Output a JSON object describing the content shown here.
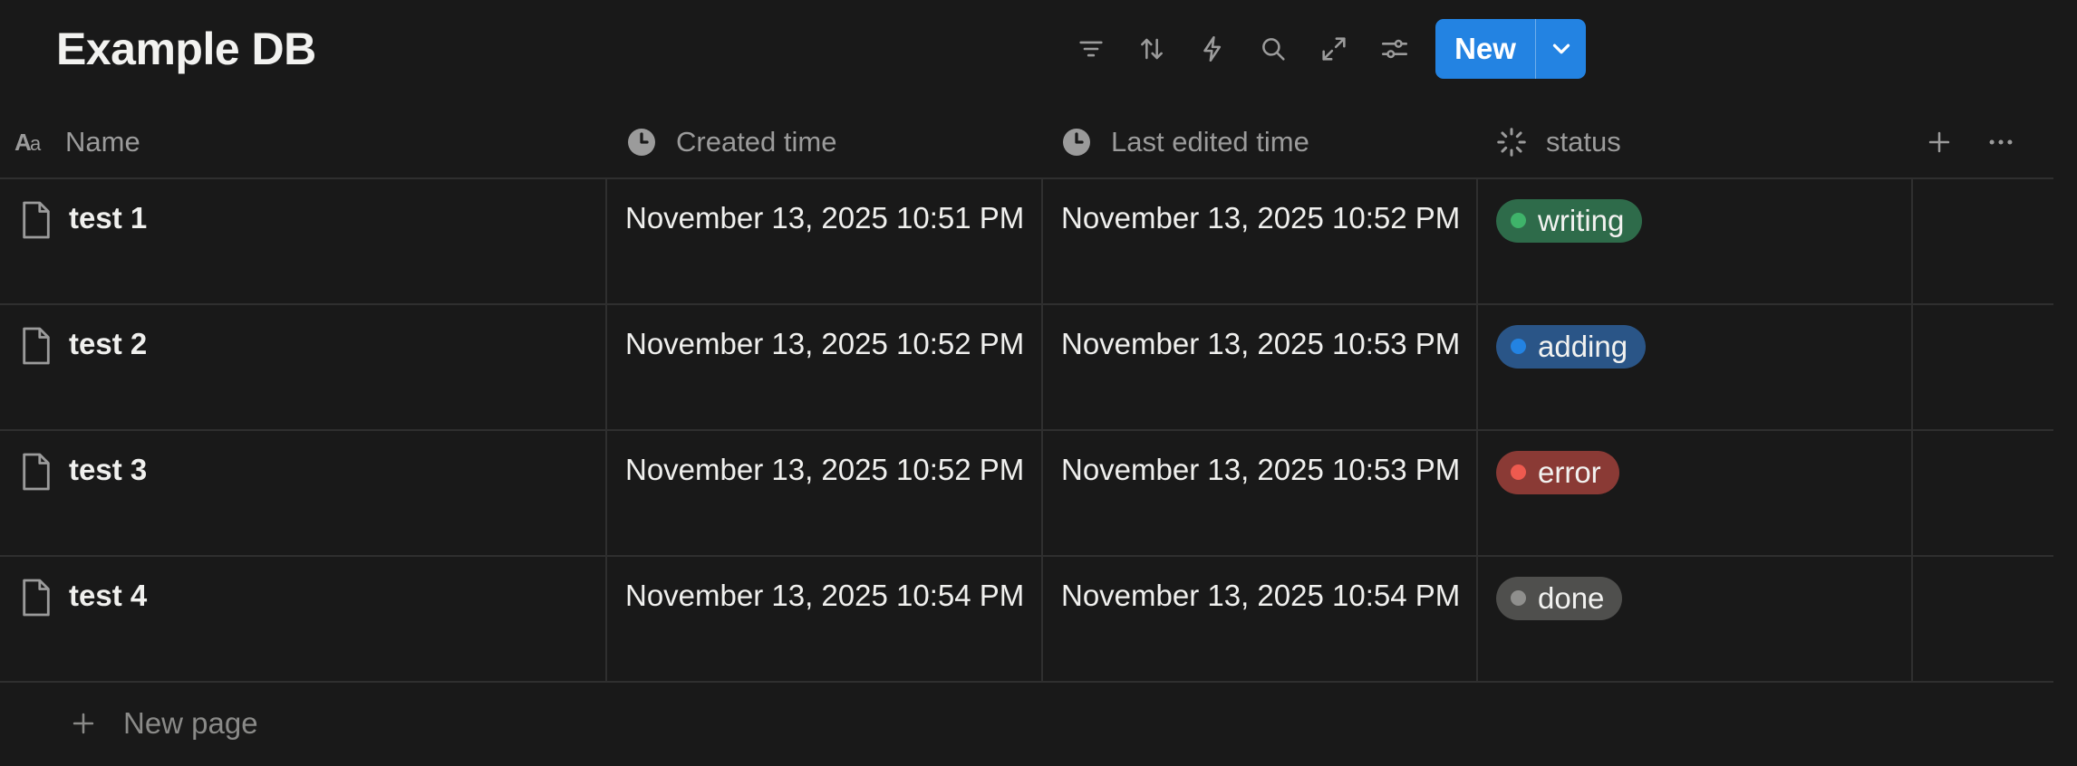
{
  "database": {
    "title": "Example DB"
  },
  "toolbar": {
    "icons": [
      "filter-icon",
      "sort-icon",
      "automation-bolt-icon",
      "search-icon",
      "expand-icon",
      "settings-sliders-icon"
    ],
    "new_label": "New",
    "accent_color": "#2383e2"
  },
  "columns": {
    "name": "Name",
    "created": "Created time",
    "edited": "Last edited time",
    "status": "status"
  },
  "rows": [
    {
      "name": "test 1",
      "created": "November 13, 2025 10:51 PM",
      "edited": "November 13, 2025 10:52 PM",
      "status": "writing",
      "status_color": "#2e6b4a",
      "dot_color": "#3fb36a"
    },
    {
      "name": "test 2",
      "created": "November 13, 2025 10:52 PM",
      "edited": "November 13, 2025 10:53 PM",
      "status": "adding",
      "status_color": "#2a5587",
      "dot_color": "#2383e2"
    },
    {
      "name": "test 3",
      "created": "November 13, 2025 10:52 PM",
      "edited": "November 13, 2025 10:53 PM",
      "status": "error",
      "status_color": "#8a3a35",
      "dot_color": "#ee5a4f"
    },
    {
      "name": "test 4",
      "created": "November 13, 2025 10:54 PM",
      "edited": "November 13, 2025 10:54 PM",
      "status": "done",
      "status_color": "#4f4f4d",
      "dot_color": "#8f8f8d"
    }
  ],
  "footer": {
    "new_page_label": "New page"
  }
}
